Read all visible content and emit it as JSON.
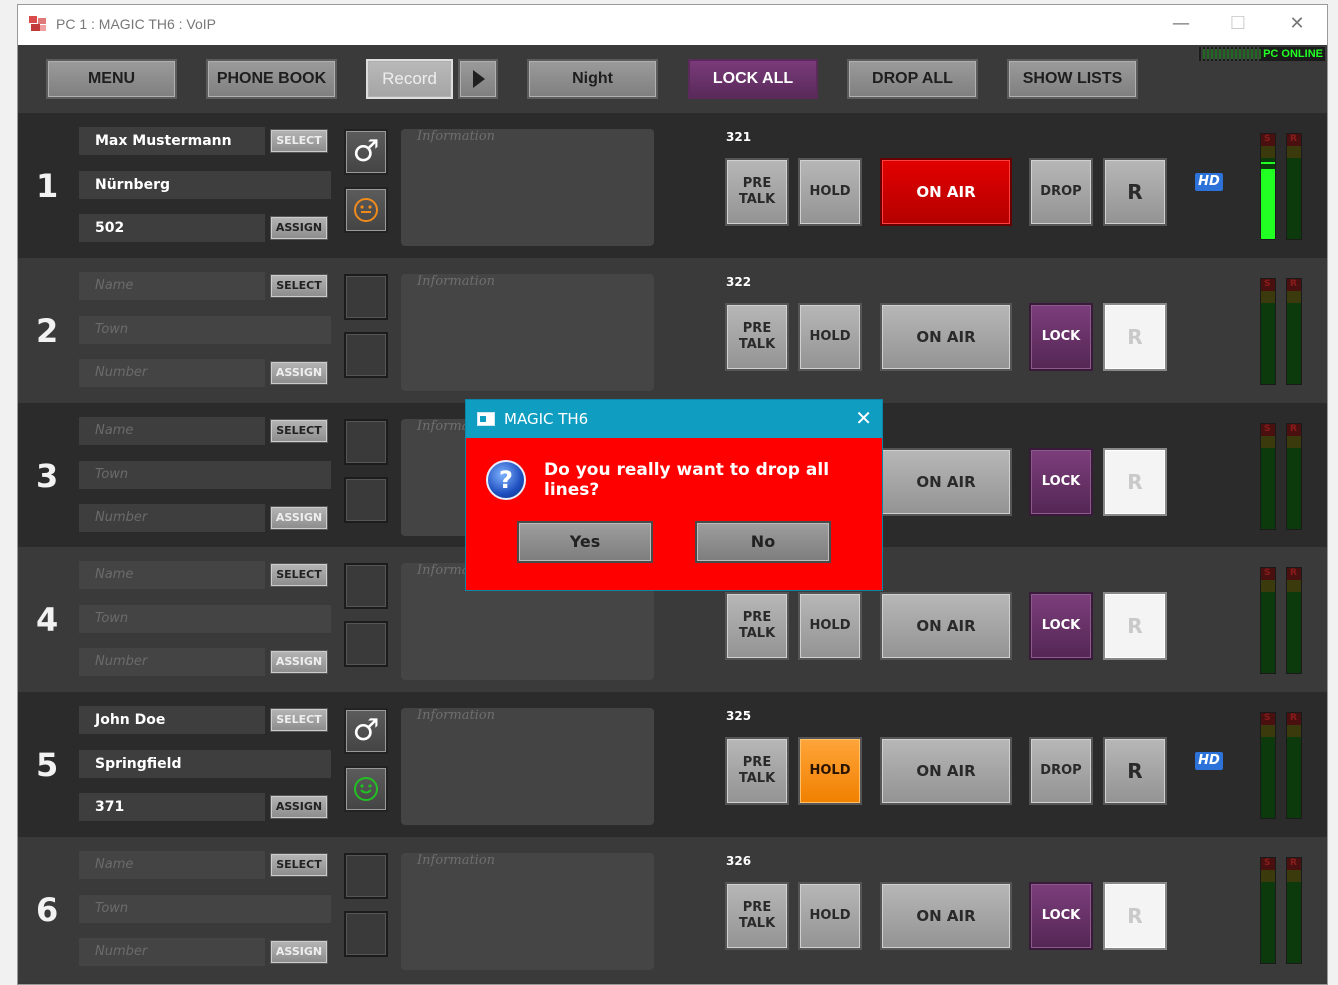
{
  "window": {
    "title": "PC 1 : MAGIC TH6 : VoIP",
    "minimize": "—",
    "maximize": "☐",
    "close": "✕"
  },
  "toolbar": {
    "menu": "MENU",
    "phone_book": "PHONE BOOK",
    "record": "Record",
    "night": "Night",
    "lock_all": "LOCK ALL",
    "drop_all": "DROP ALL",
    "show_lists": "SHOW LISTS",
    "status": "PC ONLINE"
  },
  "colors": {
    "on_air": "#d40000",
    "hold_active": "#f59020",
    "lock": "#6a306a",
    "hd": "#2c72d8",
    "dialog_bg": "#ff0000",
    "dialog_title": "#0f9ec2",
    "meter": "#22ff22"
  },
  "lines": [
    {
      "number": "1",
      "name": "Max Mustermann",
      "town": "Nürnberg",
      "phone": "502",
      "select": "SELECT",
      "assign": "ASSIGN",
      "info": "Information",
      "ext": "321",
      "pre_talk": "PRE TALK",
      "hold": "HOLD",
      "on_air": "ON AIR",
      "action": "DROP",
      "r": "R",
      "hd": "HD",
      "gender_icon": "male-icon",
      "mood_icon": "neutral-face-icon"
    },
    {
      "number": "2",
      "name": "Name",
      "town": "Town",
      "phone": "Number",
      "select": "SELECT",
      "assign": "ASSIGN",
      "info": "Information",
      "ext": "322",
      "pre_talk": "PRE TALK",
      "hold": "HOLD",
      "on_air": "ON AIR",
      "action": "LOCK",
      "r": "R"
    },
    {
      "number": "3",
      "name": "Name",
      "town": "Town",
      "phone": "Number",
      "select": "SELECT",
      "assign": "ASSIGN",
      "info": "Informa",
      "ext": "",
      "pre_talk": "",
      "hold": "",
      "on_air": "ON AIR",
      "action": "LOCK",
      "r": "R"
    },
    {
      "number": "4",
      "name": "Name",
      "town": "Town",
      "phone": "Number",
      "select": "SELECT",
      "assign": "ASSIGN",
      "info": "Informa",
      "ext": "",
      "pre_talk": "PRE TALK",
      "hold": "HOLD",
      "on_air": "ON AIR",
      "action": "LOCK",
      "r": "R"
    },
    {
      "number": "5",
      "name": "John Doe",
      "town": "Springfield",
      "phone": "371",
      "select": "SELECT",
      "assign": "ASSIGN",
      "info": "Information",
      "ext": "325",
      "pre_talk": "PRE TALK",
      "hold": "HOLD",
      "on_air": "ON AIR",
      "action": "DROP",
      "r": "R",
      "hd": "HD",
      "gender_icon": "male-icon",
      "mood_icon": "happy-face-icon"
    },
    {
      "number": "6",
      "name": "Name",
      "town": "Town",
      "phone": "Number",
      "select": "SELECT",
      "assign": "ASSIGN",
      "info": "Information",
      "ext": "326",
      "pre_talk": "PRE TALK",
      "hold": "HOLD",
      "on_air": "ON AIR",
      "action": "LOCK",
      "r": "R"
    }
  ],
  "meters": {
    "s_label": "S",
    "r_label": "R",
    "line1_level": 0.65
  },
  "dialog": {
    "title": "MAGIC TH6",
    "close": "✕",
    "icon": "question-icon",
    "message": "Do you really want to drop all lines?",
    "yes": "Yes",
    "no": "No"
  }
}
